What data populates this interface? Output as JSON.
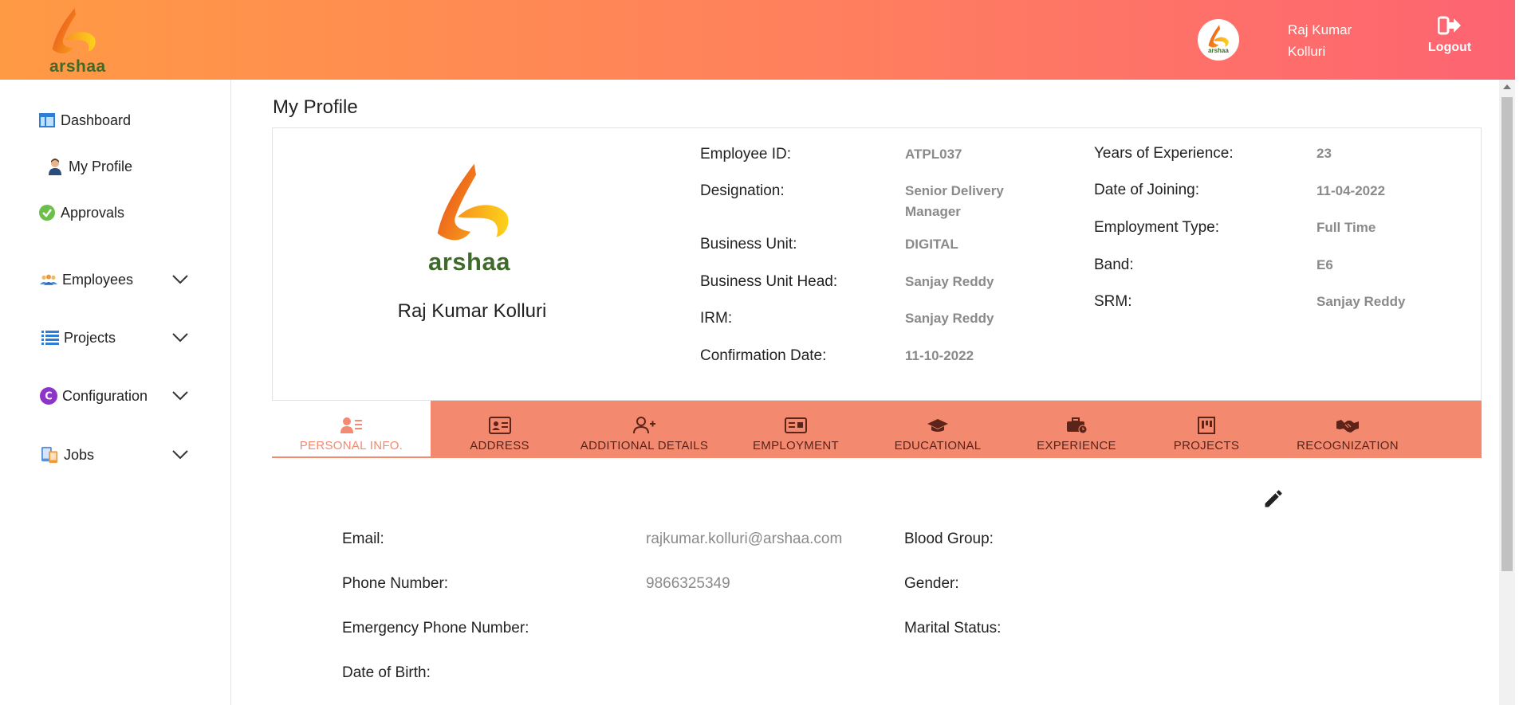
{
  "header": {
    "brand_text": "arshaa",
    "avatar_text": "arshaa",
    "user_name": "Raj Kumar Kolluri",
    "logout_label": "Logout"
  },
  "sidebar": {
    "items": [
      {
        "label": "Dashboard",
        "icon": "dashboard-icon"
      },
      {
        "label": "My Profile",
        "icon": "user-icon"
      },
      {
        "label": "Approvals",
        "icon": "check-circle-icon"
      },
      {
        "label": "Employees",
        "icon": "people-icon",
        "expandable": true
      },
      {
        "label": "Projects",
        "icon": "list-icon",
        "expandable": true
      },
      {
        "label": "Configuration",
        "icon": "c-circle-icon",
        "expandable": true
      },
      {
        "label": "Jobs",
        "icon": "devices-icon",
        "expandable": true
      }
    ]
  },
  "page": {
    "title": "My Profile"
  },
  "profile": {
    "logo_text": "arshaa",
    "name": "Raj Kumar Kolluri",
    "fields_left": [
      {
        "label": "Employee ID:",
        "value": "ATPL037"
      },
      {
        "label": "Designation:",
        "value": "Senior Delivery Manager"
      },
      {
        "label": "Business Unit:",
        "value": "DIGITAL"
      },
      {
        "label": "Business Unit Head:",
        "value": "Sanjay Reddy"
      },
      {
        "label": "IRM:",
        "value": "Sanjay Reddy"
      },
      {
        "label": "Confirmation Date:",
        "value": "11-10-2022"
      }
    ],
    "fields_right": [
      {
        "label": "Years of Experience:",
        "value": "23"
      },
      {
        "label": "Date of Joining:",
        "value": "11-04-2022"
      },
      {
        "label": "Employment Type:",
        "value": "Full Time"
      },
      {
        "label": "Band:",
        "value": "E6"
      },
      {
        "label": "SRM:",
        "value": "Sanjay Reddy"
      }
    ]
  },
  "tabs": [
    {
      "label": "PERSONAL INFO.",
      "icon": "person-info-icon",
      "active": true
    },
    {
      "label": "ADDRESS",
      "icon": "address-card-icon"
    },
    {
      "label": "ADDITIONAL DETAILS",
      "icon": "person-add-icon"
    },
    {
      "label": "EMPLOYMENT",
      "icon": "id-card-icon"
    },
    {
      "label": "EDUCATIONAL",
      "icon": "graduation-cap-icon"
    },
    {
      "label": "EXPERIENCE",
      "icon": "briefcase-clock-icon"
    },
    {
      "label": "PROJECTS",
      "icon": "board-icon"
    },
    {
      "label": "RECOGNIZATION",
      "icon": "handshake-icon"
    }
  ],
  "personal": {
    "left": [
      {
        "label": "Email:",
        "value": "rajkumar.kolluri@arshaa.com"
      },
      {
        "label": "Phone Number:",
        "value": "9866325349"
      },
      {
        "label": "Emergency Phone Number:",
        "value": ""
      },
      {
        "label": "Date of Birth:",
        "value": ""
      }
    ],
    "right": [
      {
        "label": "Blood Group:",
        "value": ""
      },
      {
        "label": "Gender:",
        "value": ""
      },
      {
        "label": "Marital Status:",
        "value": ""
      }
    ]
  },
  "colors": {
    "header_start": "#ff9a44",
    "header_end": "#fd6472",
    "tab_bar": "#f3896f",
    "tab_label": "#5c2318",
    "brand_green": "#3e6b2a",
    "value_gray": "#8a8a8a"
  }
}
